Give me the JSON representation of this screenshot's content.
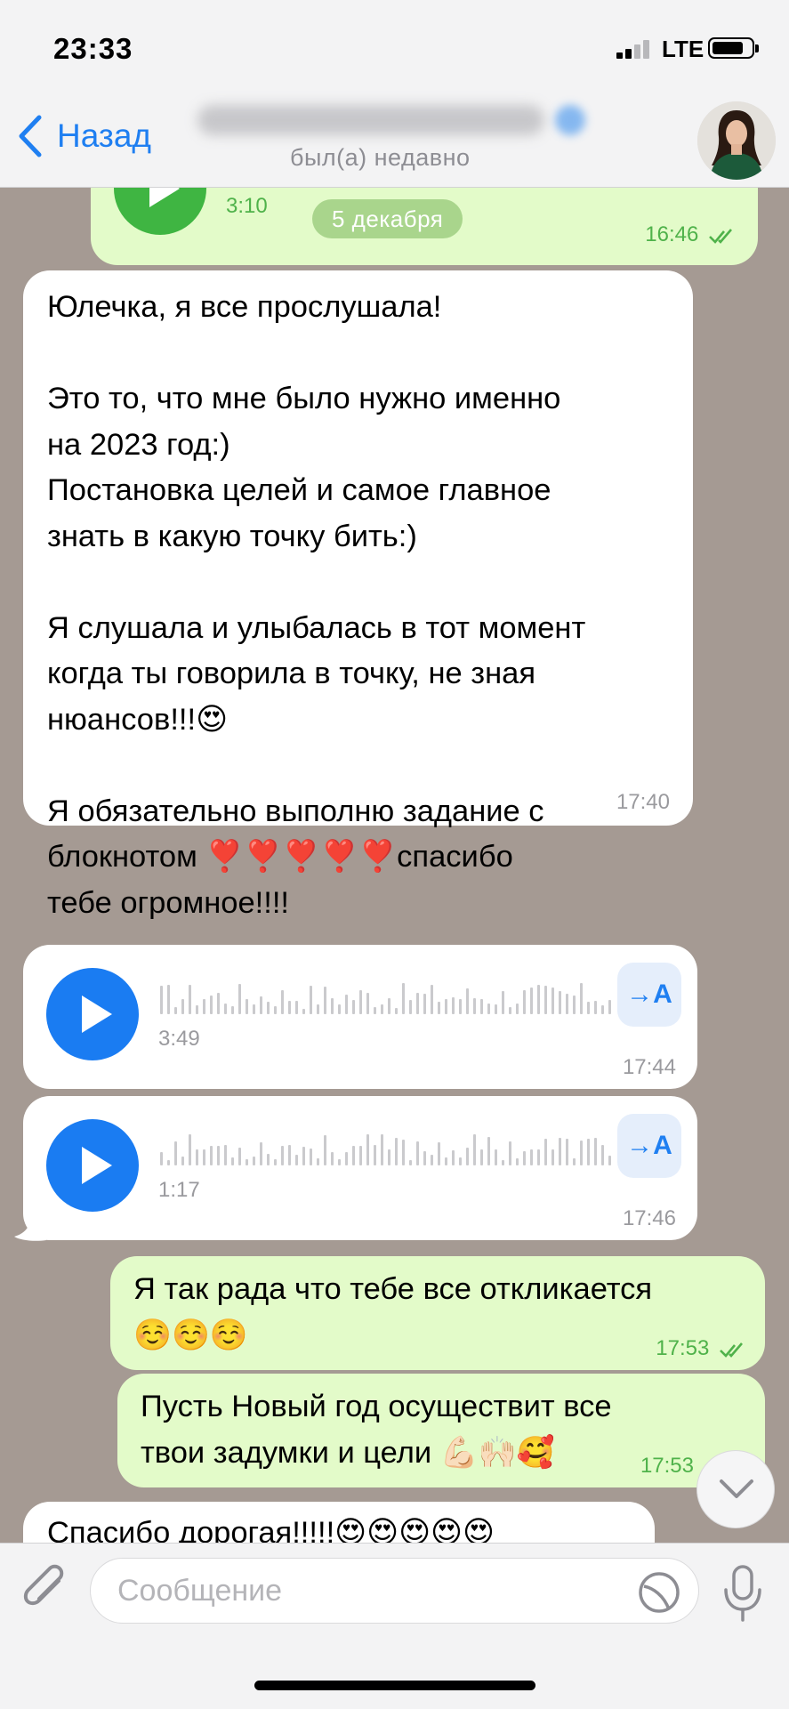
{
  "status_bar": {
    "time": "23:33",
    "network": "LTE"
  },
  "header": {
    "back_label": "Назад",
    "contact_status": "был(а) недавно"
  },
  "messages": {
    "top_voice": {
      "duration": "3:10",
      "time": "16:46"
    },
    "date_separator": "5 декабря",
    "msg1": {
      "text": "Юлечка, я все прослушала!\n\nЭто то, что мне было нужно именно\nна 2023 год:)\nПостановка целей и самое главное\nзнать в какую точку бить:)\n\nЯ слушала и улыбалась в тот момент\nкогда ты говорила в точку, не зная\nнюансов!!!😍\n\nЯ обязательно выполню задание с\nблокнотом ❣️❣️❣️❣️❣️спасибо\nтебе огромное!!!!",
      "time": "17:40"
    },
    "voice1": {
      "duration": "3:49",
      "time": "17:44",
      "transcribe_label": "→A"
    },
    "voice2": {
      "duration": "1:17",
      "time": "17:46",
      "transcribe_label": "→A"
    },
    "msg2": {
      "text": "Я так рада что тебе все откликается\n☺️☺️☺️",
      "time": "17:53"
    },
    "msg3": {
      "text": "Пусть Новый год осуществит все\nтвои задумки и цели 💪🏻🙌🏻🥰",
      "time": "17:53"
    },
    "msg4": {
      "text": "Спасибо дорогая!!!!!😍😍😍😍😍"
    }
  },
  "input": {
    "placeholder": "Сообщение"
  },
  "colors": {
    "accent": "#1f7ff1",
    "outgoing_bubble": "#e3fbc9",
    "incoming_bubble": "#ffffff",
    "chat_background": "#a59a93"
  }
}
